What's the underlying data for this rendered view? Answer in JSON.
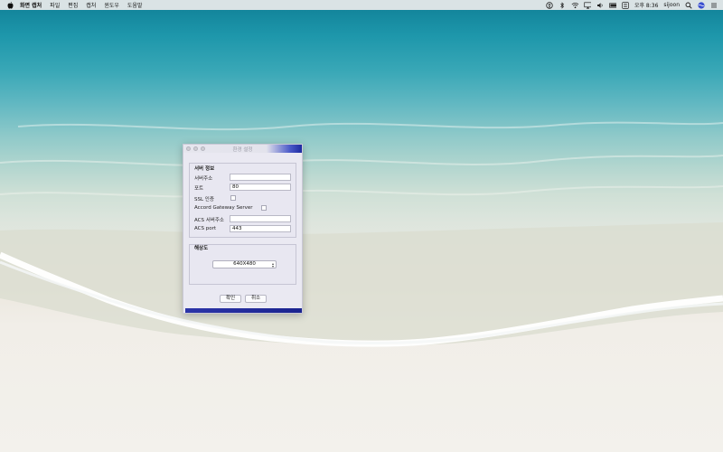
{
  "menubar": {
    "app_name": "화면 캡처",
    "menus": [
      "파일",
      "편집",
      "캡처",
      "윈도우",
      "도움말"
    ],
    "clock": "오후 8:36",
    "user": "sijoon",
    "icons": [
      "apple-icon",
      "accessibility-icon",
      "bluetooth-icon",
      "wifi-icon",
      "airplay-icon",
      "sound-icon",
      "battery-icon",
      "keyboard-icon",
      "search-icon",
      "siri-icon",
      "list-icon"
    ]
  },
  "dialog": {
    "title": "환경 설정",
    "server_group": {
      "label": "서버 정보",
      "server_address_label": "서버주소",
      "server_address_value": "",
      "port_label": "포트",
      "port_value": "80",
      "ssl_label": "SSL 인증",
      "ssl_checked": false,
      "gateway_label": "Accord Gateway Server",
      "gateway_checked": false,
      "acs_address_label": "ACS 서버주소",
      "acs_address_value": "",
      "acs_port_label": "ACS port",
      "acs_port_value": "443"
    },
    "resolution_group": {
      "label": "해상도",
      "selected": "640X480"
    },
    "ok_label": "확인",
    "cancel_label": "취소"
  },
  "colors": {
    "window_bg": "#eae9f2",
    "accent_blue": "#1d2aa0"
  }
}
